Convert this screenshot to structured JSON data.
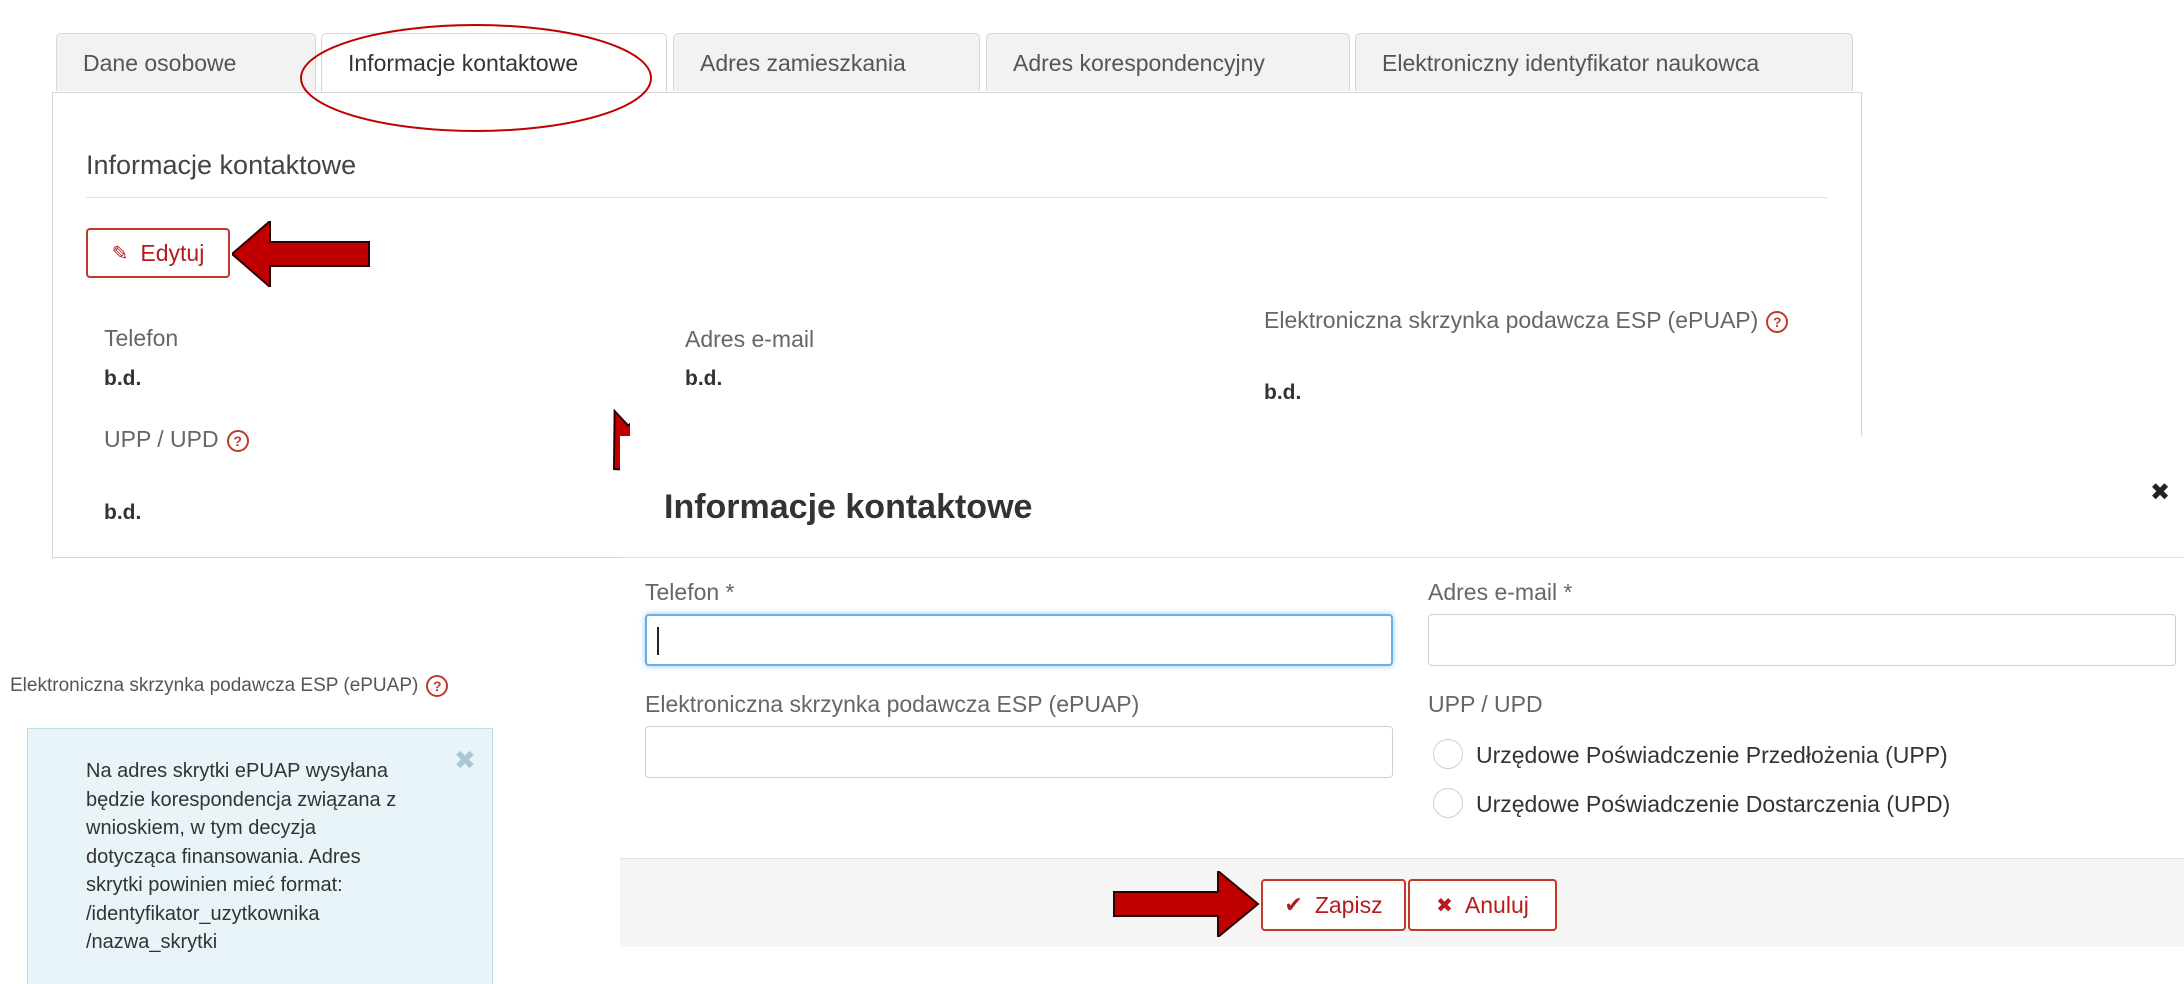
{
  "tabs": [
    "Dane osobowe",
    "Informacje kontaktowe",
    "Adres zamieszkania",
    "Adres korespondencyjny",
    "Elektroniczny identyfikator naukowca"
  ],
  "panel": {
    "heading": "Informacje kontaktowe",
    "edit_label": "Edytuj",
    "fields": {
      "telefon": {
        "label": "Telefon",
        "value": "b.d."
      },
      "email": {
        "label": "Adres e-mail",
        "value": "b.d."
      },
      "esp": {
        "label": "Elektroniczna skrzynka podawcza ESP (ePUAP)",
        "value": "b.d."
      },
      "upp": {
        "label": "UPP / UPD",
        "value": "b.d."
      }
    }
  },
  "modal": {
    "title": "Informacje kontaktowe",
    "close": "✖",
    "telefon_label": "Telefon *",
    "telefon_value": "",
    "email_label": "Adres e-mail *",
    "email_value": "",
    "esp_label": "Elektroniczna skrzynka podawcza ESP (ePUAP)",
    "esp_value": "",
    "upp_label": "UPP / UPD",
    "radio_options": [
      "Urzędowe Poświadczenie Przedłożenia (UPP)",
      "Urzędowe Poświadczenie Dostarczenia (UPD)"
    ],
    "save_label": "Zapisz",
    "cancel_label": "Anuluj"
  },
  "side_note": {
    "label": "Elektroniczna skrzynka podawcza ESP (ePUAP)",
    "text_lines": [
      "Na adres skrytki ePUAP wysyłana",
      "będzie korespondencja związana z",
      "wnioskiem, w tym decyzja",
      "dotycząca finansowania. Adres",
      "skrytki powinien mieć format:",
      "/identyfikator_uzytkownika",
      "/nazwa_skrytki"
    ]
  },
  "colors": {
    "accent_red": "#c00000",
    "brand_red": "#b71c1c",
    "focus_blue": "#66afe9",
    "info_bg": "#e8f4f8"
  }
}
